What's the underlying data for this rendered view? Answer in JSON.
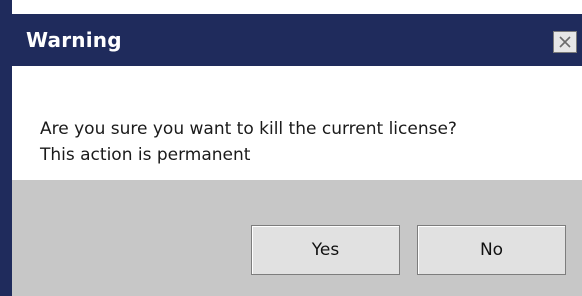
{
  "window": {
    "title": "Warning",
    "close_icon": "close-icon"
  },
  "message": {
    "line1": "Are you sure you want to kill the current license?",
    "line2": "This action is permanent"
  },
  "buttons": {
    "yes_label": "Yes",
    "no_label": "No"
  },
  "colors": {
    "titlebar": "#1f2b5c",
    "content_background": "#ffffff",
    "button_bar_background": "#c7c7c7",
    "button_face": "#e1e1e1"
  }
}
